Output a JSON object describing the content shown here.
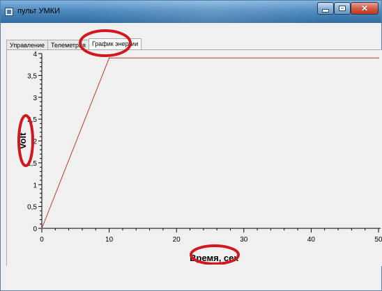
{
  "window": {
    "title": "пульт УМКИ",
    "minimize_icon": "minimize-icon",
    "maximize_icon": "maximize-icon",
    "close_icon": "close-icon"
  },
  "tabs": [
    {
      "label": "Управление",
      "active": false
    },
    {
      "label": "Телеметрия",
      "active": false
    },
    {
      "label": "График энергии",
      "active": true
    }
  ],
  "annotations_color": "#d0181e",
  "chart_data": {
    "type": "line",
    "title": "",
    "xlabel": "Время, сек",
    "ylabel": "Volt",
    "xlim": [
      0,
      50
    ],
    "ylim": [
      0,
      4
    ],
    "x_ticks": [
      "0",
      "10",
      "20",
      "30",
      "40",
      "50"
    ],
    "y_ticks": [
      "0",
      "0,5",
      "1",
      "1,5",
      "2",
      "2,5",
      "3",
      "3,5",
      "4"
    ],
    "grid": false,
    "series": [
      {
        "color": "#c0392b",
        "x": [
          0,
          10,
          50
        ],
        "y": [
          0,
          3.9,
          3.9
        ]
      }
    ]
  }
}
